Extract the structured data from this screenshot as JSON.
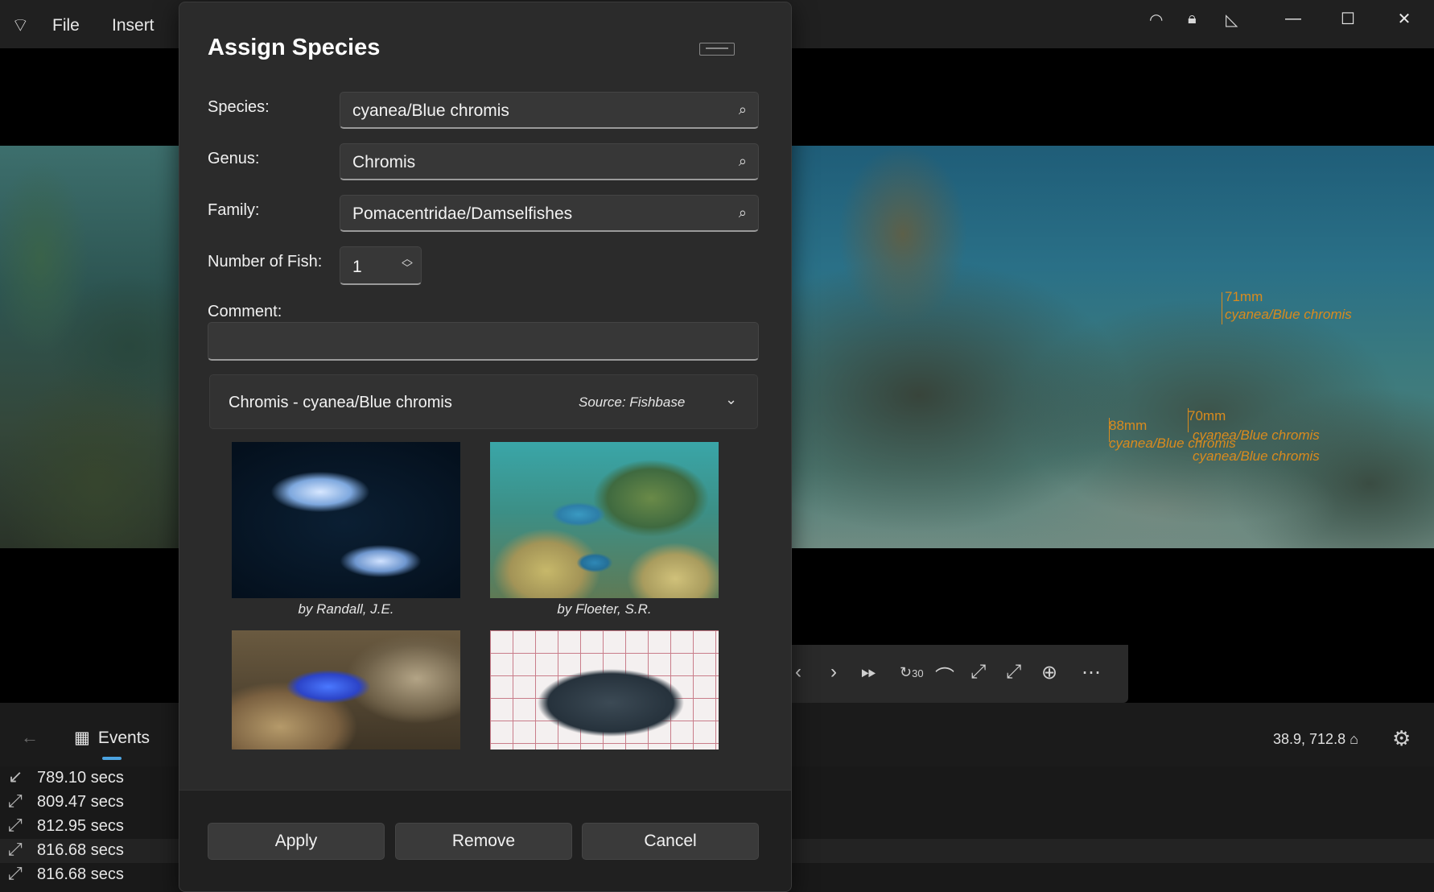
{
  "app": {
    "menu": [
      "File",
      "Insert"
    ],
    "status_icons": [
      "wifi-icon",
      "lock-icon",
      "ruler-icon"
    ],
    "window_buttons": [
      "minimize-icon",
      "maximize-icon",
      "close-icon"
    ]
  },
  "video": {
    "annotations": [
      {
        "length": "71mm",
        "species": "cyanea/Blue chromis"
      },
      {
        "length": "70mm",
        "species": "cyanea/Blue chromis"
      },
      {
        "length": "88mm",
        "species": "cyanea/Blue chromis"
      },
      {
        "length": "",
        "species": "cyanea/Blue chromis"
      }
    ]
  },
  "player": {
    "buttons": [
      "prev-icon",
      "next-icon",
      "fast-forward-icon",
      "skip-30-icon",
      "measure-icon",
      "expand-icon",
      "expand-alt-icon",
      "zoom-in-icon",
      "more-icon"
    ],
    "skip_label": "30"
  },
  "bottom": {
    "events_tab": "Events",
    "coords": "38.9, 712.8"
  },
  "events": [
    {
      "time": "789.10 secs"
    },
    {
      "time": "809.47 secs"
    },
    {
      "time": "812.95 secs"
    },
    {
      "time": "816.68 secs"
    },
    {
      "time": "816.68 secs"
    }
  ],
  "dialog": {
    "title": "Assign Species",
    "species_label": "Species:",
    "species_value": "cyanea/Blue chromis",
    "genus_label": "Genus:",
    "genus_value": "Chromis",
    "family_label": "Family:",
    "family_value": "Pomacentridae/Damselfishes",
    "number_label": "Number of Fish:",
    "number_value": "1",
    "comment_label": "Comment:",
    "comment_value": "",
    "expander_title": "Chromis - cyanea/Blue chromis",
    "expander_source": "Source: Fishbase",
    "photos": [
      {
        "credit": "by Randall, J.E."
      },
      {
        "credit": "by Floeter, S.R."
      },
      {
        "credit": ""
      },
      {
        "credit": ""
      }
    ],
    "buttons": {
      "apply": "Apply",
      "remove": "Remove",
      "cancel": "Cancel"
    }
  },
  "colors": {
    "accent": "#4ca3e0",
    "annotation": "#d98b1e",
    "dialog_bg": "#2b2b2b"
  }
}
